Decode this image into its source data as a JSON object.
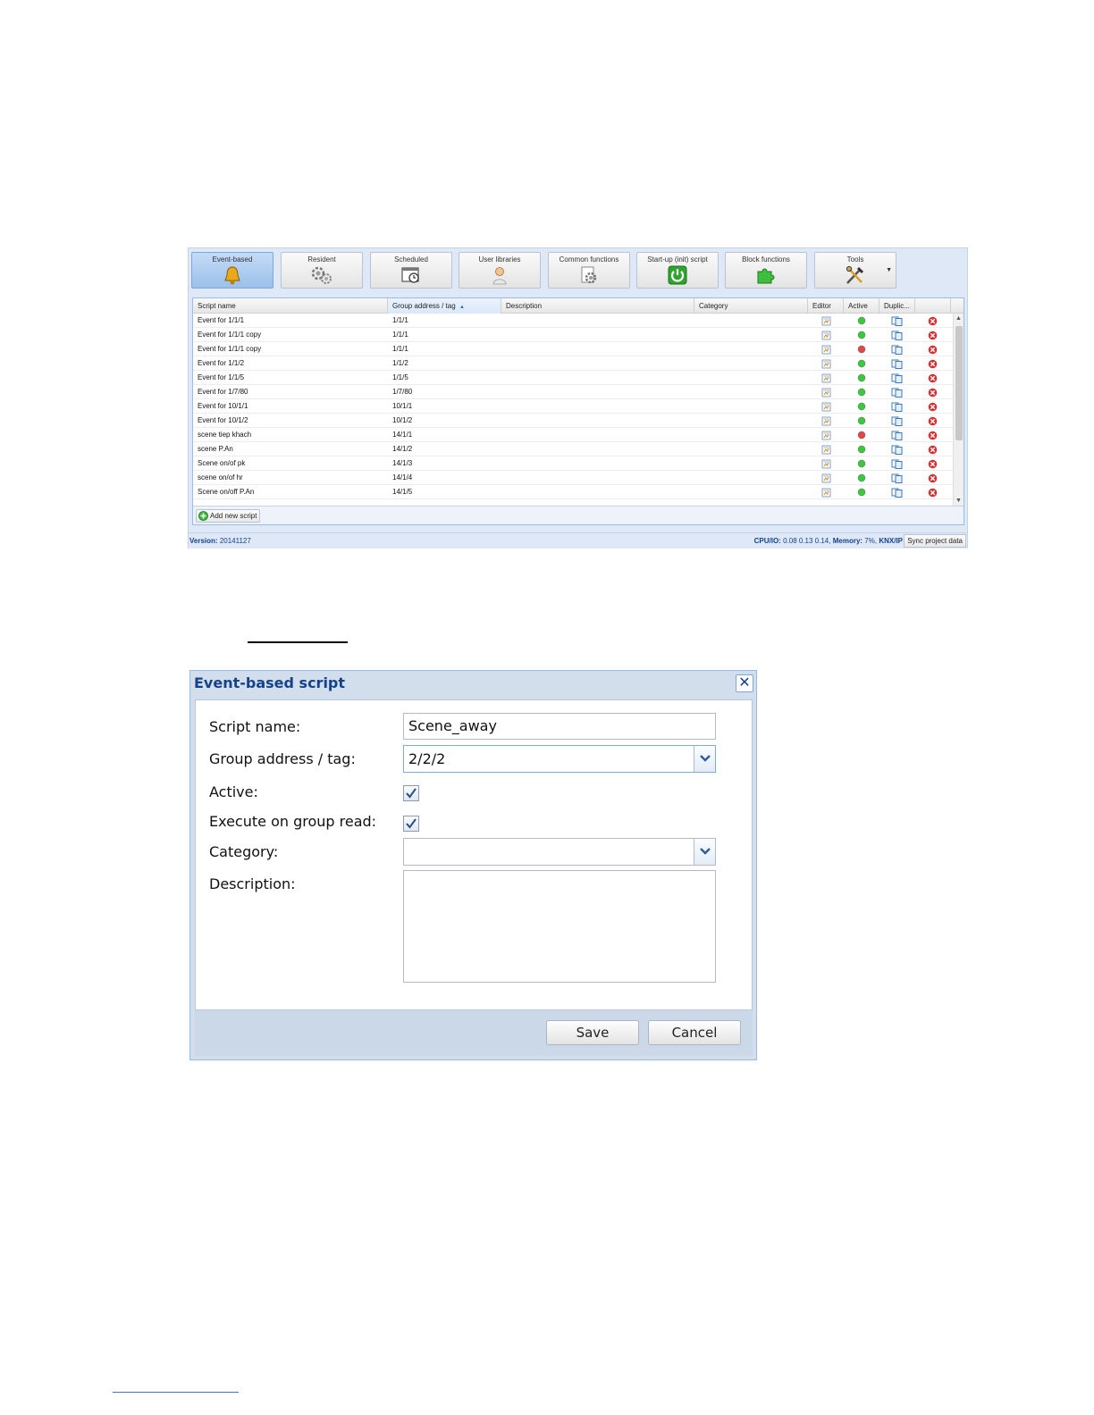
{
  "toolbar": {
    "buttons": [
      {
        "label": "Event-based",
        "icon": "bell-icon",
        "active": true
      },
      {
        "label": "Resident",
        "icon": "gears-icon",
        "active": false
      },
      {
        "label": "Scheduled",
        "icon": "calendar-clock-icon",
        "active": false
      },
      {
        "label": "User libraries",
        "icon": "user-icon",
        "active": false
      },
      {
        "label": "Common functions",
        "icon": "gear-document-icon",
        "active": false
      },
      {
        "label": "Start-up (init) script",
        "icon": "power-icon",
        "active": false
      },
      {
        "label": "Block functions",
        "icon": "puzzle-icon",
        "active": false
      },
      {
        "label": "Tools",
        "icon": "tools-icon",
        "active": false
      }
    ]
  },
  "grid": {
    "columns": [
      "Script name",
      "Group address / tag",
      "Description",
      "Category",
      "Editor",
      "Active",
      "Duplic..."
    ],
    "sort_indicator": "▲",
    "rows": [
      {
        "name": "Event for 1/1/1",
        "address": "1/1/1",
        "active": true
      },
      {
        "name": "Event for 1/1/1 copy",
        "address": "1/1/1",
        "active": true
      },
      {
        "name": "Event for 1/1/1 copy",
        "address": "1/1/1",
        "active": false
      },
      {
        "name": "Event for 1/1/2",
        "address": "1/1/2",
        "active": true
      },
      {
        "name": "Event for 1/1/5",
        "address": "1/1/5",
        "active": true
      },
      {
        "name": "Event for 1/7/80",
        "address": "1/7/80",
        "active": true
      },
      {
        "name": "Event for 10/1/1",
        "address": "10/1/1",
        "active": true
      },
      {
        "name": "Event for 10/1/2",
        "address": "10/1/2",
        "active": true
      },
      {
        "name": "scene tiep khach",
        "address": "14/1/1",
        "active": false
      },
      {
        "name": "scene P.An",
        "address": "14/1/2",
        "active": true
      },
      {
        "name": "Scene on/of pk",
        "address": "14/1/3",
        "active": true
      },
      {
        "name": "scene on/of hr",
        "address": "14/1/4",
        "active": true
      },
      {
        "name": "Scene on/off P.An",
        "address": "14/1/5",
        "active": true
      }
    ],
    "add_button": "Add new script"
  },
  "statusbar": {
    "version_label": "Version:",
    "version_value": "20141127",
    "cpu_label": "CPU/IO:",
    "cpu_value": "0.08 0.13 0.14,",
    "memory_label": "Memory:",
    "memory_value": "7%,",
    "knx_label": "KNX/IP",
    "sync_button": "Sync project data"
  },
  "dialog": {
    "title": "Event-based script",
    "fields": {
      "script_name_label": "Script name:",
      "script_name_value": "Scene_away",
      "group_address_label": "Group address / tag:",
      "group_address_value": "2/2/2",
      "active_label": "Active:",
      "active_checked": true,
      "execute_label": "Execute on group read:",
      "execute_checked": true,
      "category_label": "Category:",
      "category_value": "",
      "description_label": "Description:",
      "description_value": ""
    },
    "save_button": "Save",
    "cancel_button": "Cancel"
  },
  "colors": {
    "accent": "#15428b",
    "active_green": "#3cc83c",
    "inactive_red": "#e04848",
    "delete_red": "#d92f2f"
  }
}
